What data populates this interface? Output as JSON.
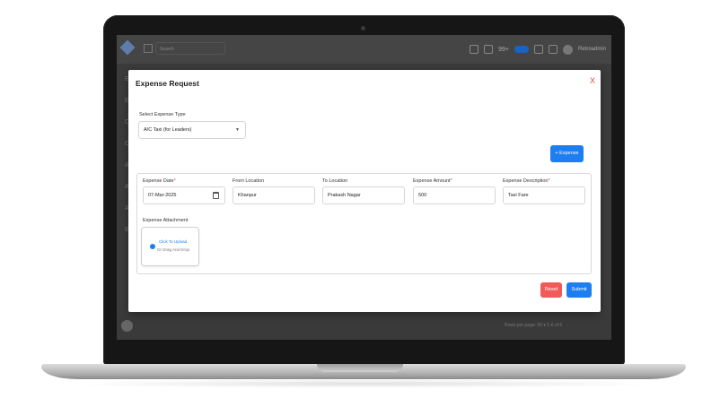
{
  "topbar": {
    "search_placeholder": "Search",
    "notification_count": "99+",
    "user_name": "Retroadmin"
  },
  "sidebar": {
    "letters": [
      "E",
      "E",
      "C",
      "C",
      "A",
      "A",
      "A",
      "E"
    ]
  },
  "footer": {
    "rows_per_page": "Rows per page: 50 ▾   1-6 of 6"
  },
  "modal": {
    "title": "Expense Request",
    "close_label": "X",
    "expense_type_label": "Select Expense Type",
    "expense_type_value": "A/C Taxi (for Leaders)",
    "add_expense_label": "+ Expense",
    "fields": {
      "date": {
        "label": "Expense Date",
        "value": "07-Mar-2025"
      },
      "from": {
        "label": "From Location",
        "value": "Khanpur"
      },
      "to": {
        "label": "To Location",
        "value": "Prakash Nagar"
      },
      "amount": {
        "label": "Expense Amount",
        "value": "500"
      },
      "description": {
        "label": "Expense Description",
        "value": "Taxi Fare"
      }
    },
    "attachment_label": "Expense Attachment",
    "upload_main": "Click To Upload",
    "upload_sub": "Or Drag And Drop",
    "required_mark": "*",
    "reset_label": "Reset",
    "submit_label": "Submit"
  },
  "colors": {
    "primary": "#1e7ef0",
    "danger": "#f25a5a",
    "close": "#e5483f"
  }
}
